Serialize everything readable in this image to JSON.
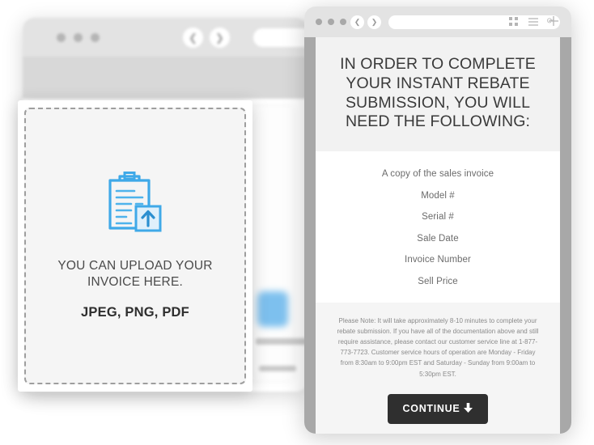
{
  "background_window": {
    "name": "background-browser-window",
    "traffic_dots": 3,
    "nav_back_icon": "chevron-left-icon",
    "nav_forward_icon": "chevron-right-icon",
    "address_bar_value": "",
    "address_bar_placeholder": ""
  },
  "upload_card": {
    "icon": "clipboard-upload-icon",
    "title": "YOU CAN UPLOAD YOUR INVOICE HERE.",
    "formats": "JPEG, PNG, PDF",
    "icon_color": "#3fa9e8",
    "border_style": "dashed",
    "border_color": "#9e9e9e"
  },
  "right_window": {
    "chrome": {
      "traffic_dots": 3,
      "nav_back_icon": "chevron-left-icon",
      "nav_forward_icon": "chevron-right-icon",
      "address_bar_value": "",
      "address_bar_placeholder": "",
      "reload_icon": "reload-icon",
      "grid_icon": "grid-view-icon",
      "menu_icon": "hamburger-menu-icon",
      "new_tab_icon": "plus-icon"
    },
    "hero": {
      "title": "IN ORDER TO COMPLETE YOUR INSTANT REBATE SUBMISSION, YOU WILL NEED THE FOLLOWING:",
      "background": "#f2f2f2"
    },
    "requirements": [
      "A copy of the sales invoice",
      "Model #",
      "Serial #",
      "Sale Date",
      "Invoice Number",
      "Sell Price"
    ],
    "note": "Please Note: It will take approximately 8-10 minutes to complete your rebate submission. If you have all of the documentation above and still require assistance, please contact our customer service line at 1-877-773-7723. Customer service hours of operation are Monday - Friday from 8:30am to 9:00pm EST and Saturday - Sunday from 9:00am to 5:30pm EST.",
    "continue_button": {
      "label": "CONTINUE",
      "icon": "arrow-down-icon",
      "background": "#2f2f2f",
      "text_color": "#ffffff"
    }
  }
}
